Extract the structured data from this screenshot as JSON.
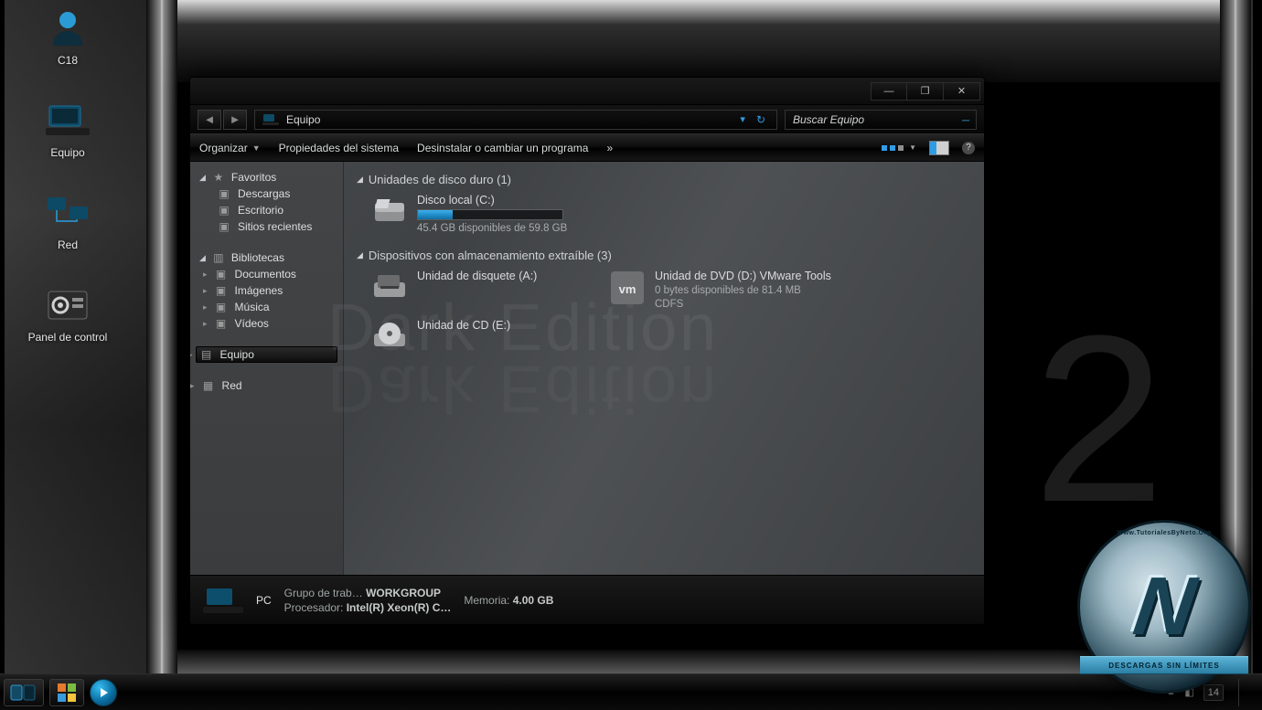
{
  "desktop": {
    "icons": [
      {
        "id": "user",
        "label": "C18"
      },
      {
        "id": "computer",
        "label": "Equipo"
      },
      {
        "id": "network",
        "label": "Red"
      },
      {
        "id": "control",
        "label": "Panel de control"
      }
    ]
  },
  "window": {
    "controls": {
      "min": "—",
      "max": "❐",
      "close": "✕"
    },
    "address": {
      "label": "Equipo"
    },
    "search": {
      "placeholder": "Buscar Equipo"
    },
    "toolbar": {
      "organize": "Organizar",
      "sysprops": "Propiedades del sistema",
      "uninstall": "Desinstalar o cambiar un programa",
      "overflow": "»"
    },
    "nav": {
      "favorites": {
        "label": "Favoritos",
        "items": [
          {
            "label": "Descargas"
          },
          {
            "label": "Escritorio"
          },
          {
            "label": "Sitios recientes"
          }
        ]
      },
      "libraries": {
        "label": "Bibliotecas",
        "items": [
          {
            "label": "Documentos"
          },
          {
            "label": "Imágenes"
          },
          {
            "label": "Música"
          },
          {
            "label": "Vídeos"
          }
        ]
      },
      "computer": {
        "label": "Equipo"
      },
      "network": {
        "label": "Red"
      }
    },
    "sections": {
      "hdd": {
        "title": "Unidades de disco duro (1)"
      },
      "removable": {
        "title": "Dispositivos con almacenamiento extraíble (3)"
      }
    },
    "drives": {
      "c": {
        "name": "Disco local (C:)",
        "free": "45.4 GB disponibles de 59.8 GB",
        "used_pct": 24
      },
      "a": {
        "name": "Unidad de disquete (A:)"
      },
      "e": {
        "name": "Unidad de CD (E:)"
      },
      "d": {
        "name": "Unidad de DVD (D:) VMware Tools",
        "free": "0 bytes disponibles de 81.4 MB",
        "fs": "CDFS"
      }
    },
    "details": {
      "name": "PC",
      "workgroup_k": "Grupo de trab…",
      "workgroup_v": "WORKGROUP",
      "memory_k": "Memoria:",
      "memory_v": "4.00 GB",
      "cpu_k": "Procesador:",
      "cpu_v": "Intel(R) Xeon(R) C…"
    },
    "watermark": "Dark Edition"
  },
  "taskbar": {
    "tray_chev": "▲",
    "tray_icon": "◧",
    "clock": "14"
  },
  "logo": {
    "top": "Www.TutorialesByNeto.Org",
    "ribbon": "Descargas Sin Límites"
  }
}
